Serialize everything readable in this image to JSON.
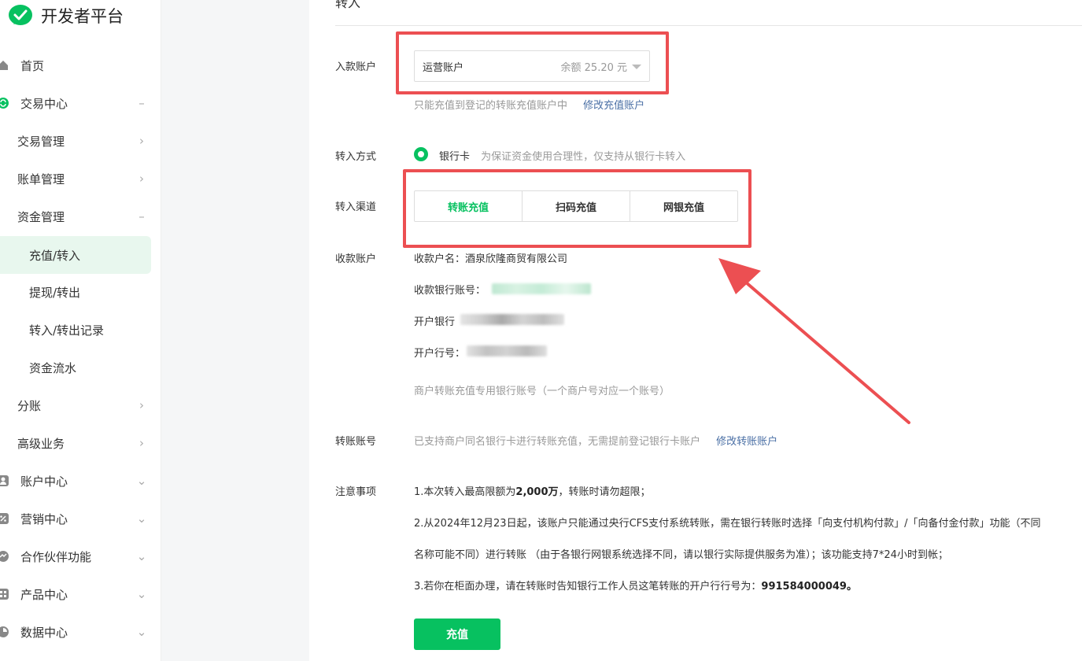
{
  "brand": {
    "title": "开发者平台"
  },
  "sidebar": {
    "items": [
      {
        "label": "首页",
        "icon": "home-icon"
      },
      {
        "label": "交易中心",
        "icon": "refresh-icon",
        "state": "expanded"
      },
      {
        "label": "交易管理"
      },
      {
        "label": "账单管理"
      },
      {
        "label": "资金管理",
        "state": "expanded"
      },
      {
        "label": "充值/转入",
        "active": true
      },
      {
        "label": "提现/转出"
      },
      {
        "label": "转入/转出记录"
      },
      {
        "label": "资金流水"
      },
      {
        "label": "分账"
      },
      {
        "label": "高级业务"
      },
      {
        "label": "账户中心",
        "icon": "user-icon"
      },
      {
        "label": "营销中心",
        "icon": "percent-icon"
      },
      {
        "label": "合作伙伴功能",
        "icon": "partner-icon"
      },
      {
        "label": "产品中心",
        "icon": "grid-icon"
      },
      {
        "label": "数据中心",
        "icon": "chart-icon"
      }
    ]
  },
  "main": {
    "page_title": "转入",
    "deposit_account": {
      "label": "入款账户",
      "selected": "运营账户",
      "balance": "余额 25.20 元",
      "hint": "只能充值到登记的转账充值账户中",
      "link": "修改充值账户"
    },
    "method": {
      "label": "转入方式",
      "option": "银行卡",
      "hint": "为保证资金使用合理性，仅支持从银行卡转入"
    },
    "channel": {
      "label": "转入渠道",
      "tabs": [
        "转账充值",
        "扫码充值",
        "网银充值"
      ]
    },
    "payee": {
      "label": "收款账户",
      "name_label": "收款户名：",
      "name_value": "酒泉欣隆商贸有限公司",
      "account_label": "收款银行账号：",
      "bank_label": "开户银行",
      "bank_no_label": "开户行号：",
      "note": "商户转账充值专用银行账号（一个商户号对应一个账号）"
    },
    "transfer_account": {
      "label": "转账账号",
      "hint": "已支持商户同名银行卡进行转账充值，无需提前登记银行卡账户",
      "link": "修改转账账户"
    },
    "notes": {
      "label": "注意事项",
      "line1_pre": "1.本次转入最高限额为",
      "line1_bold": "2,000万",
      "line1_post": "，转账时请勿超限；",
      "line2": "2.从2024年12月23日起，该账户只能通过央行CFS支付系统转账，需在银行转账时选择「向支付机构付款」/「向备付金付款」功能（不同",
      "line3": "名称可能不同）进行转账 （由于各银行网银系统选择不同，请以银行实际提供服务为准）；该功能支持7*24小时到帐；",
      "line4_pre": "3.若你在柜面办理，请在转账时告知银行工作人员这笔转账的开户行行号为：",
      "line4_bold": "991584000049。"
    },
    "submit_label": "充值"
  },
  "colors": {
    "accent": "#07c160",
    "annotation": "#ec4f52",
    "link": "#4a6fa5"
  }
}
